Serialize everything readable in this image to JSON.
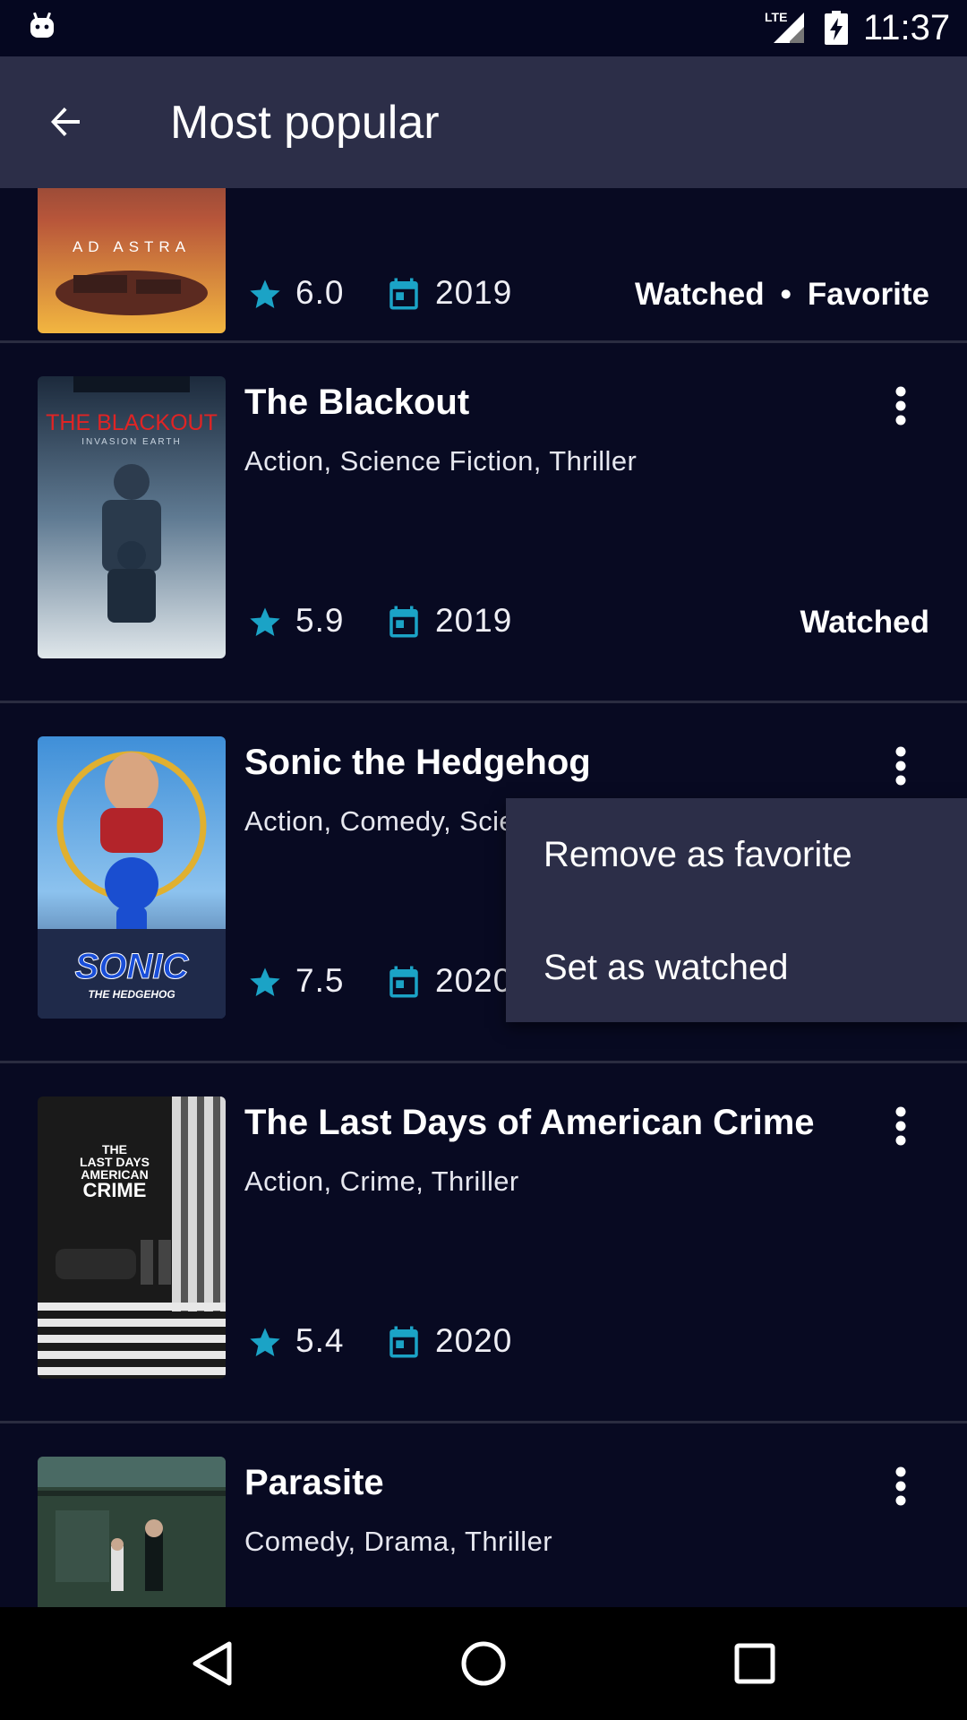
{
  "status_bar": {
    "time": "11:37",
    "network": "LTE"
  },
  "app_bar": {
    "title": "Most popular",
    "back_icon": "arrow-back-icon"
  },
  "movies": [
    {
      "title": "Ad Astra",
      "genres": "",
      "rating": "6.0",
      "year": "2019",
      "tags": [
        "Watched",
        "Favorite"
      ]
    },
    {
      "title": "The Blackout",
      "genres": "Action, Science Fiction, Thriller",
      "rating": "5.9",
      "year": "2019",
      "tags": [
        "Watched"
      ]
    },
    {
      "title": "Sonic the Hedgehog",
      "genres": "Action, Comedy, Science Fiction",
      "rating": "7.5",
      "year": "2020",
      "tags": []
    },
    {
      "title": "The Last Days of American Crime",
      "genres": "Action, Crime, Thriller",
      "rating": "5.4",
      "year": "2020",
      "tags": []
    },
    {
      "title": "Parasite",
      "genres": "Comedy, Drama, Thriller",
      "rating": "",
      "year": "",
      "tags": []
    }
  ],
  "poster_text": {
    "ad_astra": "AD ASTRA",
    "blackout_line1": "THE BLACKOUT",
    "blackout_line2": "INVASION EARTH",
    "sonic_line1": "SONIC",
    "sonic_line2": "THE HEDGEHOG",
    "crime_line1": "THE",
    "crime_line2": "LAST DAYS",
    "crime_line3": "AMERICAN",
    "crime_line4": "CRIME"
  },
  "context_menu": {
    "items": [
      "Remove as favorite",
      "Set as watched"
    ]
  },
  "colors": {
    "accent": "#1ba3c6",
    "background": "#080a22",
    "app_bar": "#2c2e48",
    "menu": "#2c2e48"
  }
}
